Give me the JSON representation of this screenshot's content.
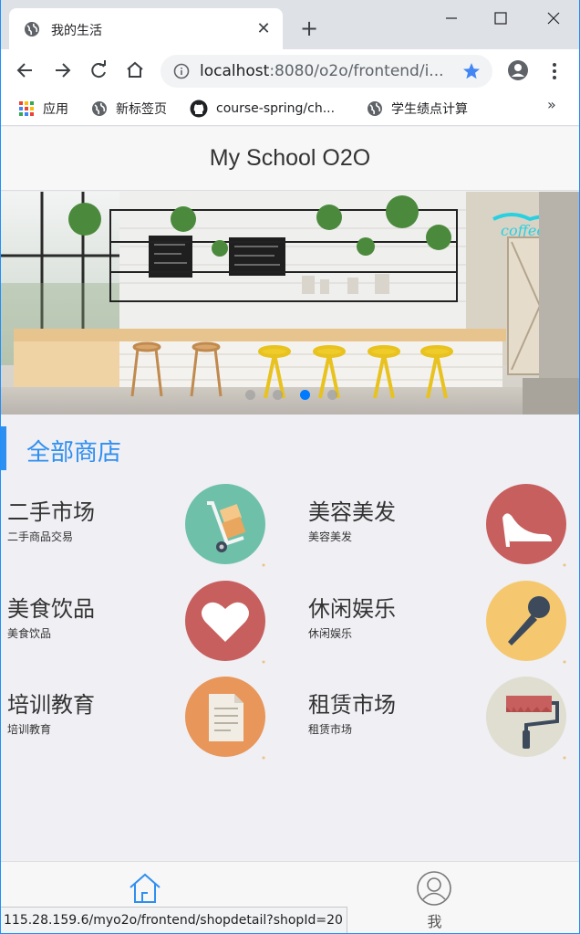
{
  "browser": {
    "tab_title": "我的生活",
    "tab_close": "✕",
    "new_tab": "+",
    "url_host": "localhost",
    "url_path": ":8080/o2o/frontend/i...",
    "bookmarks": [
      {
        "label": "应用",
        "icon": "apps-grid-icon"
      },
      {
        "label": "新标签页",
        "icon": "globe-icon"
      },
      {
        "label": "course-spring/ch...",
        "icon": "github-icon"
      },
      {
        "label": "学生绩点计算",
        "icon": "globe-icon"
      }
    ],
    "bookmarks_more": "»",
    "accent": "#4285f4"
  },
  "page": {
    "title": "My School O2O",
    "carousel": {
      "slide_count": 4,
      "active_index": 2
    },
    "section_title": "全部商店",
    "categories": [
      {
        "name": "二手市场",
        "desc": "二手商品交易",
        "icon": "cart-icon",
        "color": "#6fc0a9"
      },
      {
        "name": "美容美发",
        "desc": "美容美发",
        "icon": "high-heel-icon",
        "color": "#c75f5e"
      },
      {
        "name": "美食饮品",
        "desc": "美食饮品",
        "icon": "heart-icon",
        "color": "#c75f5e"
      },
      {
        "name": "休闲娱乐",
        "desc": "休闲娱乐",
        "icon": "microphone-icon",
        "color": "#f5c86f"
      },
      {
        "name": "培训教育",
        "desc": "培训教育",
        "icon": "document-icon",
        "color": "#e8965a"
      },
      {
        "name": "租赁市场",
        "desc": "租赁市场",
        "icon": "paint-roller-icon",
        "color": "#e0ded0"
      }
    ],
    "tabbar": [
      {
        "label": "",
        "icon": "home-icon"
      },
      {
        "label": "我",
        "icon": "user-icon"
      }
    ],
    "accent": "#2f8ff0"
  },
  "statusbar": {
    "url": "115.28.159.6/myo2o/frontend/shopdetail?shopId=20"
  }
}
